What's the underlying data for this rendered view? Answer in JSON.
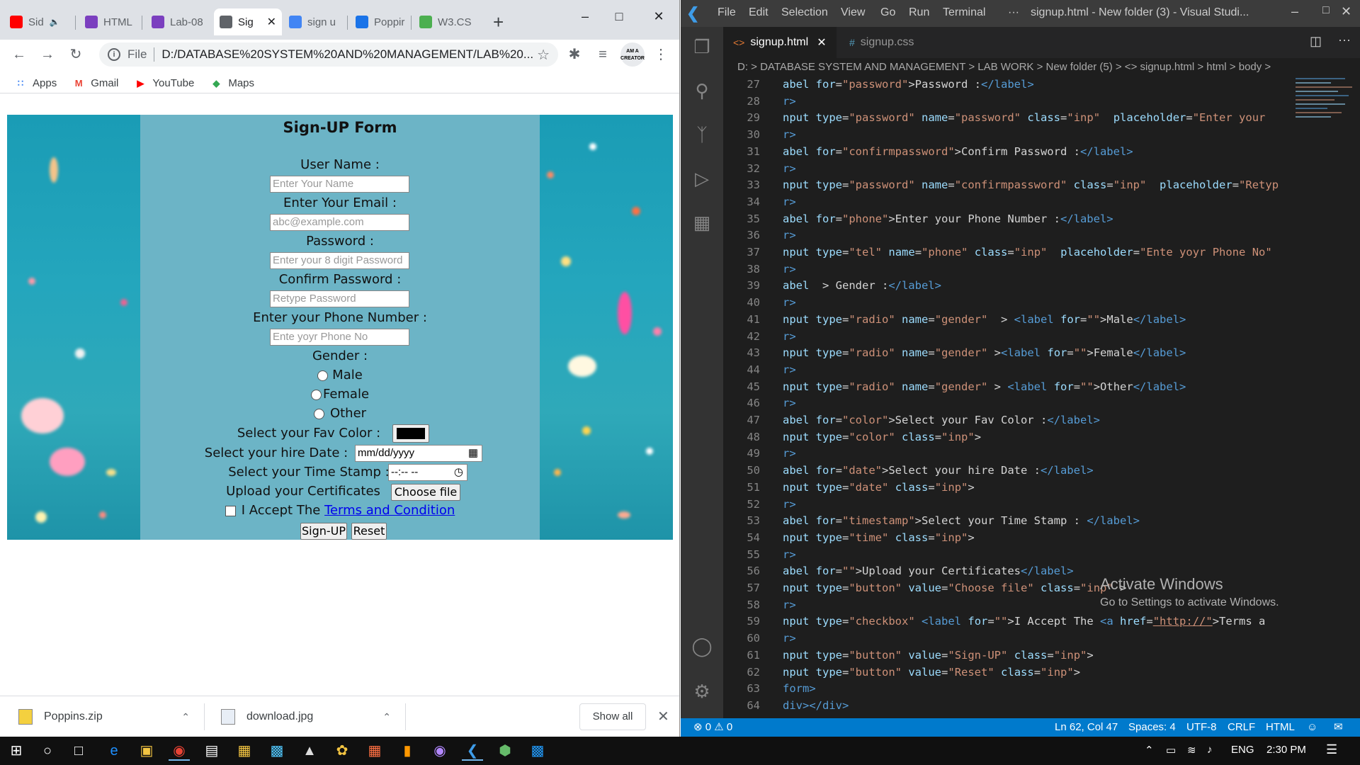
{
  "chrome": {
    "tabs": [
      {
        "label": "Sid",
        "favicon": "youtube",
        "color": "#ff0000",
        "muted": true
      },
      {
        "label": "HTML",
        "favicon": "classroom",
        "color": "#7b3fbf"
      },
      {
        "label": "Lab-08",
        "favicon": "classroom",
        "color": "#7b3fbf"
      },
      {
        "label": "Sig",
        "favicon": "globe",
        "color": "#5f6368",
        "active": true
      },
      {
        "label": "sign u",
        "favicon": "google",
        "color": "#4285f4"
      },
      {
        "label": "Poppir",
        "favicon": "fonts",
        "color": "#1a73e8"
      },
      {
        "label": "W3.CS",
        "favicon": "w3",
        "color": "#4caf50"
      }
    ],
    "address": {
      "scheme": "File",
      "url": "D:/DATABASE%20SYSTEM%20AND%20MANAGEMENT/LAB%20..."
    },
    "profile_badge": "AM A CREATOR",
    "bookmarks": [
      {
        "label": "Apps",
        "icon": "apps-grid"
      },
      {
        "label": "Gmail",
        "icon": "gmail"
      },
      {
        "label": "YouTube",
        "icon": "youtube"
      },
      {
        "label": "Maps",
        "icon": "maps"
      }
    ],
    "downloads": [
      {
        "name": "Poppins.zip",
        "icon": "zip-file"
      },
      {
        "name": "download.jpg",
        "icon": "image-file"
      }
    ],
    "show_all": "Show all"
  },
  "form": {
    "title": "Sign-UP Form",
    "username_label": "User Name :",
    "username_placeholder": "Enter Your Name",
    "email_label": "Enter Your Email :",
    "email_placeholder": "abc@example.com",
    "password_label": "Password :",
    "password_placeholder": "Enter your 8 digit Password",
    "confirm_label": "Confirm Password :",
    "confirm_placeholder": "Retype Password",
    "phone_label": "Enter your Phone Number :",
    "phone_placeholder": "Ente yoyr Phone No",
    "gender_label": "Gender :",
    "gender_options": [
      "Male",
      "Female",
      "Other"
    ],
    "color_label": "Select your Fav Color :",
    "color_value": "#000000",
    "date_label": "Select your hire Date :",
    "date_placeholder": "mm/dd/yyyy",
    "time_label": "Select your Time Stamp :",
    "time_placeholder": "--:-- --",
    "upload_label": "Upload your Certificates",
    "choose_file": "Choose file",
    "terms_prefix": "I Accept The",
    "terms_link": "Terms and Condition",
    "signup_button": "Sign-UP",
    "reset_button": "Reset"
  },
  "vscode": {
    "menu": [
      "File",
      "Edit",
      "Selection",
      "View",
      "Go",
      "Run",
      "Terminal",
      "···"
    ],
    "window_title": "signup.html - New folder (3) - Visual Studi...",
    "tabs": [
      {
        "label": "signup.html",
        "icon": "<>",
        "active": true
      },
      {
        "label": "signup.css",
        "icon": "#"
      }
    ],
    "breadcrumb": "D: > DATABASE SYSTEM AND MANAGEMENT > LAB WORK > New folder (5) > <> signup.html > html > body >",
    "code_lines": [
      {
        "n": "27",
        "html": "<span class='c-attr'>abel</span> <span class='c-attr'>for</span>=<span class='c-str'>\"password\"</span>&gt;Password :<span class='c-tag'>&lt;/label&gt;</span>"
      },
      {
        "n": "28",
        "html": "<span class='c-tag'>r&gt;</span>"
      },
      {
        "n": "29",
        "html": "<span class='c-attr'>nput</span> <span class='c-attr'>type</span>=<span class='c-str'>\"password\"</span> <span class='c-attr'>name</span>=<span class='c-str'>\"password\"</span> <span class='c-attr'>class</span>=<span class='c-str'>\"inp\"</span>  <span class='c-attr'>placeholder</span>=<span class='c-str'>\"Enter your</span>"
      },
      {
        "n": "30",
        "html": "<span class='c-tag'>r&gt;</span>"
      },
      {
        "n": "31",
        "html": "<span class='c-attr'>abel</span> <span class='c-attr'>for</span>=<span class='c-str'>\"confirmpassword\"</span>&gt;Confirm Password :<span class='c-tag'>&lt;/label&gt;</span>"
      },
      {
        "n": "32",
        "html": "<span class='c-tag'>r&gt;</span>"
      },
      {
        "n": "33",
        "html": "<span class='c-attr'>nput</span> <span class='c-attr'>type</span>=<span class='c-str'>\"password\"</span> <span class='c-attr'>name</span>=<span class='c-str'>\"confirmpassword\"</span> <span class='c-attr'>class</span>=<span class='c-str'>\"inp\"</span>  <span class='c-attr'>placeholder</span>=<span class='c-str'>\"Retyp</span>"
      },
      {
        "n": "34",
        "html": "<span class='c-tag'>r&gt;</span>"
      },
      {
        "n": "35",
        "html": "<span class='c-attr'>abel</span> <span class='c-attr'>for</span>=<span class='c-str'>\"phone\"</span>&gt;Enter your Phone Number :<span class='c-tag'>&lt;/label&gt;</span>"
      },
      {
        "n": "36",
        "html": "<span class='c-tag'>r&gt;</span>"
      },
      {
        "n": "37",
        "html": "<span class='c-attr'>nput</span> <span class='c-attr'>type</span>=<span class='c-str'>\"tel\"</span> <span class='c-attr'>name</span>=<span class='c-str'>\"phone\"</span> <span class='c-attr'>class</span>=<span class='c-str'>\"inp\"</span>  <span class='c-attr'>placeholder</span>=<span class='c-str'>\"Ente yoyr Phone No\"</span>"
      },
      {
        "n": "38",
        "html": "<span class='c-tag'>r&gt;</span>"
      },
      {
        "n": "39",
        "html": "<span class='c-attr'>abel</span>  &gt; Gender :<span class='c-tag'>&lt;/label&gt;</span>"
      },
      {
        "n": "40",
        "html": "<span class='c-tag'>r&gt;</span>"
      },
      {
        "n": "41",
        "html": "<span class='c-attr'>nput</span> <span class='c-attr'>type</span>=<span class='c-str'>\"radio\"</span> <span class='c-attr'>name</span>=<span class='c-str'>\"gender\"</span>  &gt; <span class='c-tag'>&lt;label</span> <span class='c-attr'>for</span>=<span class='c-str'>\"\"</span>&gt;Male<span class='c-tag'>&lt;/label&gt;</span>"
      },
      {
        "n": "42",
        "html": "<span class='c-tag'>r&gt;</span>"
      },
      {
        "n": "43",
        "html": "<span class='c-attr'>nput</span> <span class='c-attr'>type</span>=<span class='c-str'>\"radio\"</span> <span class='c-attr'>name</span>=<span class='c-str'>\"gender\"</span> &gt;<span class='c-tag'>&lt;label</span> <span class='c-attr'>for</span>=<span class='c-str'>\"\"</span>&gt;Female<span class='c-tag'>&lt;/label&gt;</span>"
      },
      {
        "n": "44",
        "html": "<span class='c-tag'>r&gt;</span>"
      },
      {
        "n": "45",
        "html": "<span class='c-attr'>nput</span> <span class='c-attr'>type</span>=<span class='c-str'>\"radio\"</span> <span class='c-attr'>name</span>=<span class='c-str'>\"gender\"</span> &gt; <span class='c-tag'>&lt;label</span> <span class='c-attr'>for</span>=<span class='c-str'>\"\"</span>&gt;Other<span class='c-tag'>&lt;/label&gt;</span>"
      },
      {
        "n": "46",
        "html": "<span class='c-tag'>r&gt;</span>"
      },
      {
        "n": "47",
        "html": "<span class='c-attr'>abel</span> <span class='c-attr'>for</span>=<span class='c-str'>\"color\"</span>&gt;Select your Fav Color :<span class='c-tag'>&lt;/label&gt;</span>"
      },
      {
        "n": "48",
        "html": "<span class='c-attr'>nput</span> <span class='c-attr'>type</span>=<span class='c-str'>\"color\"</span> <span class='c-attr'>class</span>=<span class='c-str'>\"inp\"</span>&gt;"
      },
      {
        "n": "49",
        "html": "<span class='c-tag'>r&gt;</span>"
      },
      {
        "n": "50",
        "html": "<span class='c-attr'>abel</span> <span class='c-attr'>for</span>=<span class='c-str'>\"date\"</span>&gt;Select your hire Date :<span class='c-tag'>&lt;/label&gt;</span>"
      },
      {
        "n": "51",
        "html": "<span class='c-attr'>nput</span> <span class='c-attr'>type</span>=<span class='c-str'>\"date\"</span> <span class='c-attr'>class</span>=<span class='c-str'>\"inp\"</span>&gt;"
      },
      {
        "n": "52",
        "html": "<span class='c-tag'>r&gt;</span>"
      },
      {
        "n": "53",
        "html": "<span class='c-attr'>abel</span> <span class='c-attr'>for</span>=<span class='c-str'>\"timestamp\"</span>&gt;Select your Time Stamp : <span class='c-tag'>&lt;/label&gt;</span>"
      },
      {
        "n": "54",
        "html": "<span class='c-attr'>nput</span> <span class='c-attr'>type</span>=<span class='c-str'>\"time\"</span> <span class='c-attr'>class</span>=<span class='c-str'>\"inp\"</span>&gt;"
      },
      {
        "n": "55",
        "html": "<span class='c-tag'>r&gt;</span>"
      },
      {
        "n": "56",
        "html": "<span class='c-attr'>abel</span> <span class='c-attr'>for</span>=<span class='c-str'>\"\"</span>&gt;Upload your Certificates<span class='c-tag'>&lt;/label&gt;</span>"
      },
      {
        "n": "57",
        "html": "<span class='c-attr'>nput</span> <span class='c-attr'>type</span>=<span class='c-str'>\"button\"</span> <span class='c-attr'>value</span>=<span class='c-str'>\"Choose file\"</span> <span class='c-attr'>class</span>=<span class='c-str'>\"inp\"</span> &gt;"
      },
      {
        "n": "58",
        "html": "<span class='c-tag'>r&gt;</span>"
      },
      {
        "n": "59",
        "html": "<span class='c-attr'>nput</span> <span class='c-attr'>type</span>=<span class='c-str'>\"checkbox\"</span> <span class='c-tag'>&lt;label</span> <span class='c-attr'>for</span>=<span class='c-str'>\"\"</span>&gt;I Accept The <span class='c-tag'>&lt;a</span> <span class='c-attr'>href</span>=<span class='c-str' style='text-decoration:underline'>\"http://\"</span>&gt;Terms a"
      },
      {
        "n": "60",
        "html": "<span class='c-tag'>r&gt;</span>"
      },
      {
        "n": "61",
        "html": "<span class='c-attr'>nput</span> <span class='c-attr'>type</span>=<span class='c-str'>\"button\"</span> <span class='c-attr'>value</span>=<span class='c-str'>\"Sign-UP\"</span> <span class='c-attr'>class</span>=<span class='c-str'>\"inp\"</span>&gt;"
      },
      {
        "n": "62",
        "html": "<span class='c-attr'>nput</span> <span class='c-attr'>type</span>=<span class='c-str'>\"button\"</span> <span class='c-attr'>value</span>=<span class='c-str'>\"Reset\"</span> <span class='c-attr'>class</span>=<span class='c-str'>\"inp\"</span>&gt;"
      },
      {
        "n": "63",
        "html": "<span class='c-tag'>form&gt;</span>"
      },
      {
        "n": "64",
        "html": "<span class='c-tag'>div&gt;&lt;/div&gt;</span>"
      }
    ],
    "activate_title": "Activate Windows",
    "activate_sub": "Go to Settings to activate Windows.",
    "status": {
      "problems": "⊗ 0 ⚠ 0",
      "position": "Ln 62, Col 47",
      "spaces": "Spaces: 4",
      "encoding": "UTF-8",
      "eol": "CRLF",
      "language": "HTML"
    }
  },
  "taskbar": {
    "language": "ENG",
    "time": "2:30 PM"
  }
}
